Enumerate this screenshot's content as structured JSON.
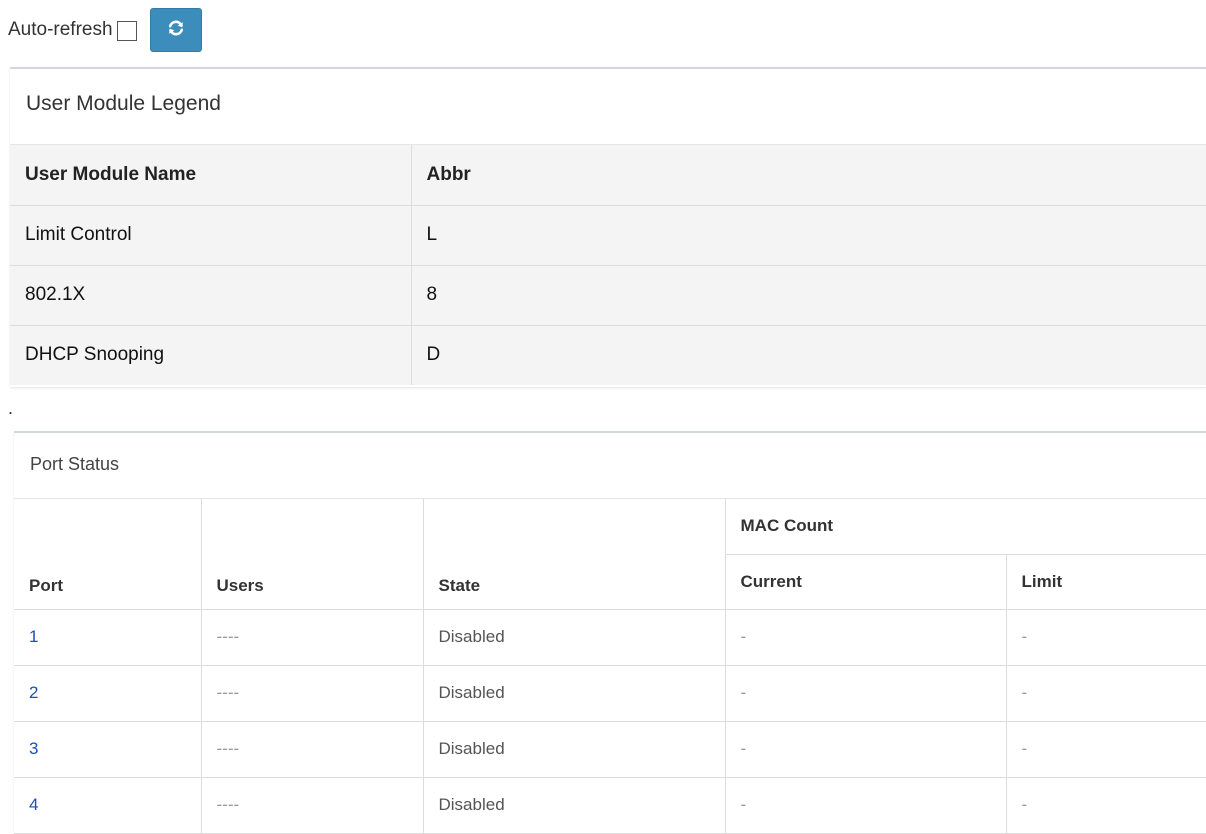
{
  "toolbar": {
    "auto_refresh_label": "Auto-refresh",
    "refresh_icon": "refresh-icon",
    "accent_color": "#3c8dbc"
  },
  "legend": {
    "title": "User Module Legend",
    "headers": [
      "User Module Name",
      "Abbr"
    ],
    "rows": [
      {
        "name": "Limit Control",
        "abbr": "L"
      },
      {
        "name": "802.1X",
        "abbr": "8"
      },
      {
        "name": "DHCP Snooping",
        "abbr": "D"
      }
    ]
  },
  "separator": ".",
  "port_status": {
    "title": "Port Status",
    "headers": {
      "port": "Port",
      "users": "Users",
      "state": "State",
      "mac_count": "MAC Count",
      "current": "Current",
      "limit": "Limit"
    },
    "rows": [
      {
        "port": "1",
        "users": "----",
        "state": "Disabled",
        "current": "-",
        "limit": "-"
      },
      {
        "port": "2",
        "users": "----",
        "state": "Disabled",
        "current": "-",
        "limit": "-"
      },
      {
        "port": "3",
        "users": "----",
        "state": "Disabled",
        "current": "-",
        "limit": "-"
      },
      {
        "port": "4",
        "users": "----",
        "state": "Disabled",
        "current": "-",
        "limit": "-"
      }
    ]
  }
}
